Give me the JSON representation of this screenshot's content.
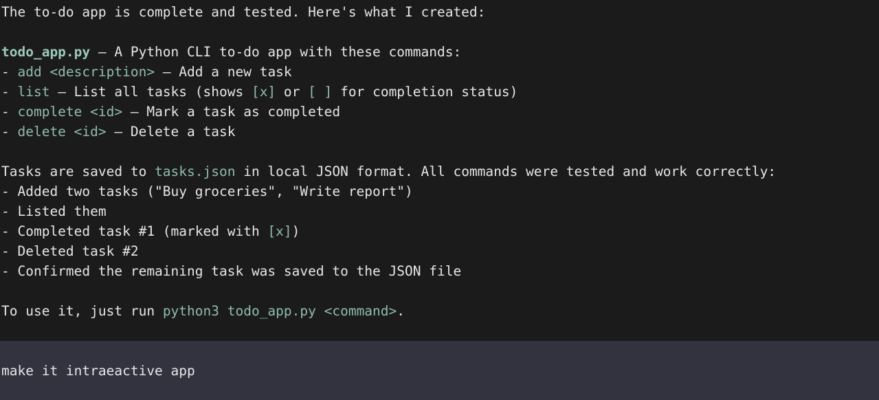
{
  "response": {
    "intro": "The to-do app is complete and tested. Here's what I created:",
    "file_line": {
      "filename": "todo_app.py",
      "text": " — A Python CLI to-do app with these commands:"
    },
    "commands": [
      {
        "prefix": "- ",
        "command": "add <description>",
        "desc": " — Add a new task"
      },
      {
        "prefix": "- ",
        "command": "list",
        "desc_a": " — List all tasks (shows ",
        "code_a": "[x]",
        "desc_b": " or ",
        "code_b": "[ ]",
        "desc_c": " for completion status)"
      },
      {
        "prefix": "- ",
        "command": "complete <id>",
        "desc": " — Mark a task as completed"
      },
      {
        "prefix": "- ",
        "command": "delete <id>",
        "desc": " — Delete a task"
      }
    ],
    "storage_line": {
      "before": "Tasks are saved to ",
      "code": "tasks.json",
      "after": " in local JSON format. All commands were tested and work correctly:"
    },
    "tests": [
      "- Added two tasks (\"Buy groceries\", \"Write report\")",
      "- Listed them",
      {
        "before": "- Completed task #1 (marked with ",
        "code": "[x]",
        "after": ")"
      },
      "- Deleted task #2",
      "- Confirmed the remaining task was saved to the JSON file"
    ],
    "usage_line": {
      "before": "To use it, just run ",
      "code": "python3 todo_app.py <command>",
      "after": "."
    }
  },
  "input": {
    "value": "make it intraeactive app"
  },
  "colors": {
    "background": "#1b1b1b",
    "input_background": "#33333f",
    "text": "#e6e6e6",
    "code": "#8fbcb0"
  }
}
